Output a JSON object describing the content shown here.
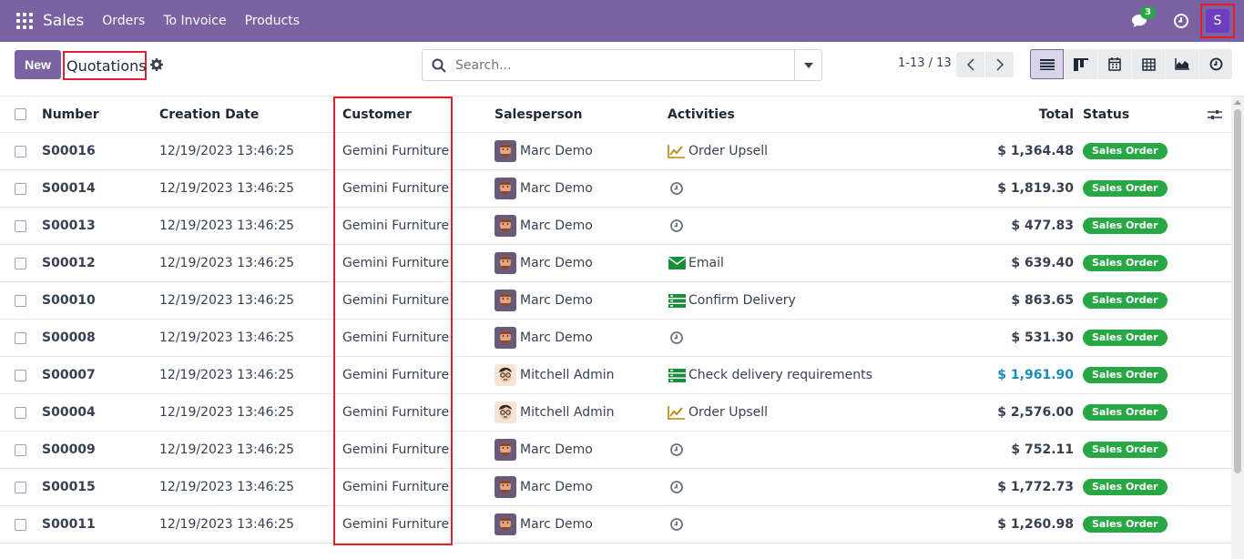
{
  "navbar": {
    "brand": "Sales",
    "menu": [
      "Orders",
      "To Invoice",
      "Products"
    ],
    "message_count": "3",
    "user_initial": "S"
  },
  "control": {
    "new_label": "New",
    "title": "Quotations",
    "search_placeholder": "Search...",
    "pager": "1-13 / 13"
  },
  "table": {
    "headers": {
      "number": "Number",
      "creation_date": "Creation Date",
      "customer": "Customer",
      "salesperson": "Salesperson",
      "activities": "Activities",
      "total": "Total",
      "status": "Status"
    },
    "rows": [
      {
        "number": "S00016",
        "date": "12/19/2023 13:46:25",
        "customer": "Gemini Furniture",
        "salesperson": "Marc Demo",
        "activity": "Order Upsell",
        "activity_icon": "upsell-chart-icon",
        "total": "$ 1,364.48",
        "status": "Sales Order"
      },
      {
        "number": "S00014",
        "date": "12/19/2023 13:46:25",
        "customer": "Gemini Furniture",
        "salesperson": "Marc Demo",
        "activity": "",
        "activity_icon": "clock-icon",
        "total": "$ 1,819.30",
        "status": "Sales Order"
      },
      {
        "number": "S00013",
        "date": "12/19/2023 13:46:25",
        "customer": "Gemini Furniture",
        "salesperson": "Marc Demo",
        "activity": "",
        "activity_icon": "clock-icon",
        "total": "$ 477.83",
        "status": "Sales Order"
      },
      {
        "number": "S00012",
        "date": "12/19/2023 13:46:25",
        "customer": "Gemini Furniture",
        "salesperson": "Marc Demo",
        "activity": "Email",
        "activity_icon": "envelope-icon",
        "total": "$ 639.40",
        "status": "Sales Order"
      },
      {
        "number": "S00010",
        "date": "12/19/2023 13:46:25",
        "customer": "Gemini Furniture",
        "salesperson": "Marc Demo",
        "activity": "Confirm Delivery",
        "activity_icon": "tasks-icon",
        "total": "$ 863.65",
        "status": "Sales Order"
      },
      {
        "number": "S00008",
        "date": "12/19/2023 13:46:25",
        "customer": "Gemini Furniture",
        "salesperson": "Marc Demo",
        "activity": "",
        "activity_icon": "clock-icon",
        "total": "$ 531.30",
        "status": "Sales Order"
      },
      {
        "number": "S00007",
        "date": "12/19/2023 13:46:25",
        "customer": "Gemini Furniture",
        "salesperson": "Mitchell Admin",
        "activity": "Check delivery requirements",
        "activity_icon": "tasks-icon",
        "total": "$ 1,961.90",
        "status": "Sales Order"
      },
      {
        "number": "S00004",
        "date": "12/19/2023 13:46:25",
        "customer": "Gemini Furniture",
        "salesperson": "Mitchell Admin",
        "activity": "Order Upsell",
        "activity_icon": "upsell-chart-icon",
        "total": "$ 2,576.00",
        "status": "Sales Order"
      },
      {
        "number": "S00009",
        "date": "12/19/2023 13:46:25",
        "customer": "Gemini Furniture",
        "salesperson": "Marc Demo",
        "activity": "",
        "activity_icon": "clock-icon",
        "total": "$ 752.11",
        "status": "Sales Order"
      },
      {
        "number": "S00015",
        "date": "12/19/2023 13:46:25",
        "customer": "Gemini Furniture",
        "salesperson": "Marc Demo",
        "activity": "",
        "activity_icon": "clock-icon",
        "total": "$ 1,772.73",
        "status": "Sales Order"
      },
      {
        "number": "S00011",
        "date": "12/19/2023 13:46:25",
        "customer": "Gemini Furniture",
        "salesperson": "Marc Demo",
        "activity": "",
        "activity_icon": "clock-icon",
        "total": "$ 1,260.98",
        "status": "Sales Order"
      }
    ]
  },
  "colors": {
    "brand": "#7a62a3",
    "status_green": "#28a745",
    "highlight_red": "#e0202a",
    "link_total": "#1a8bb5"
  }
}
